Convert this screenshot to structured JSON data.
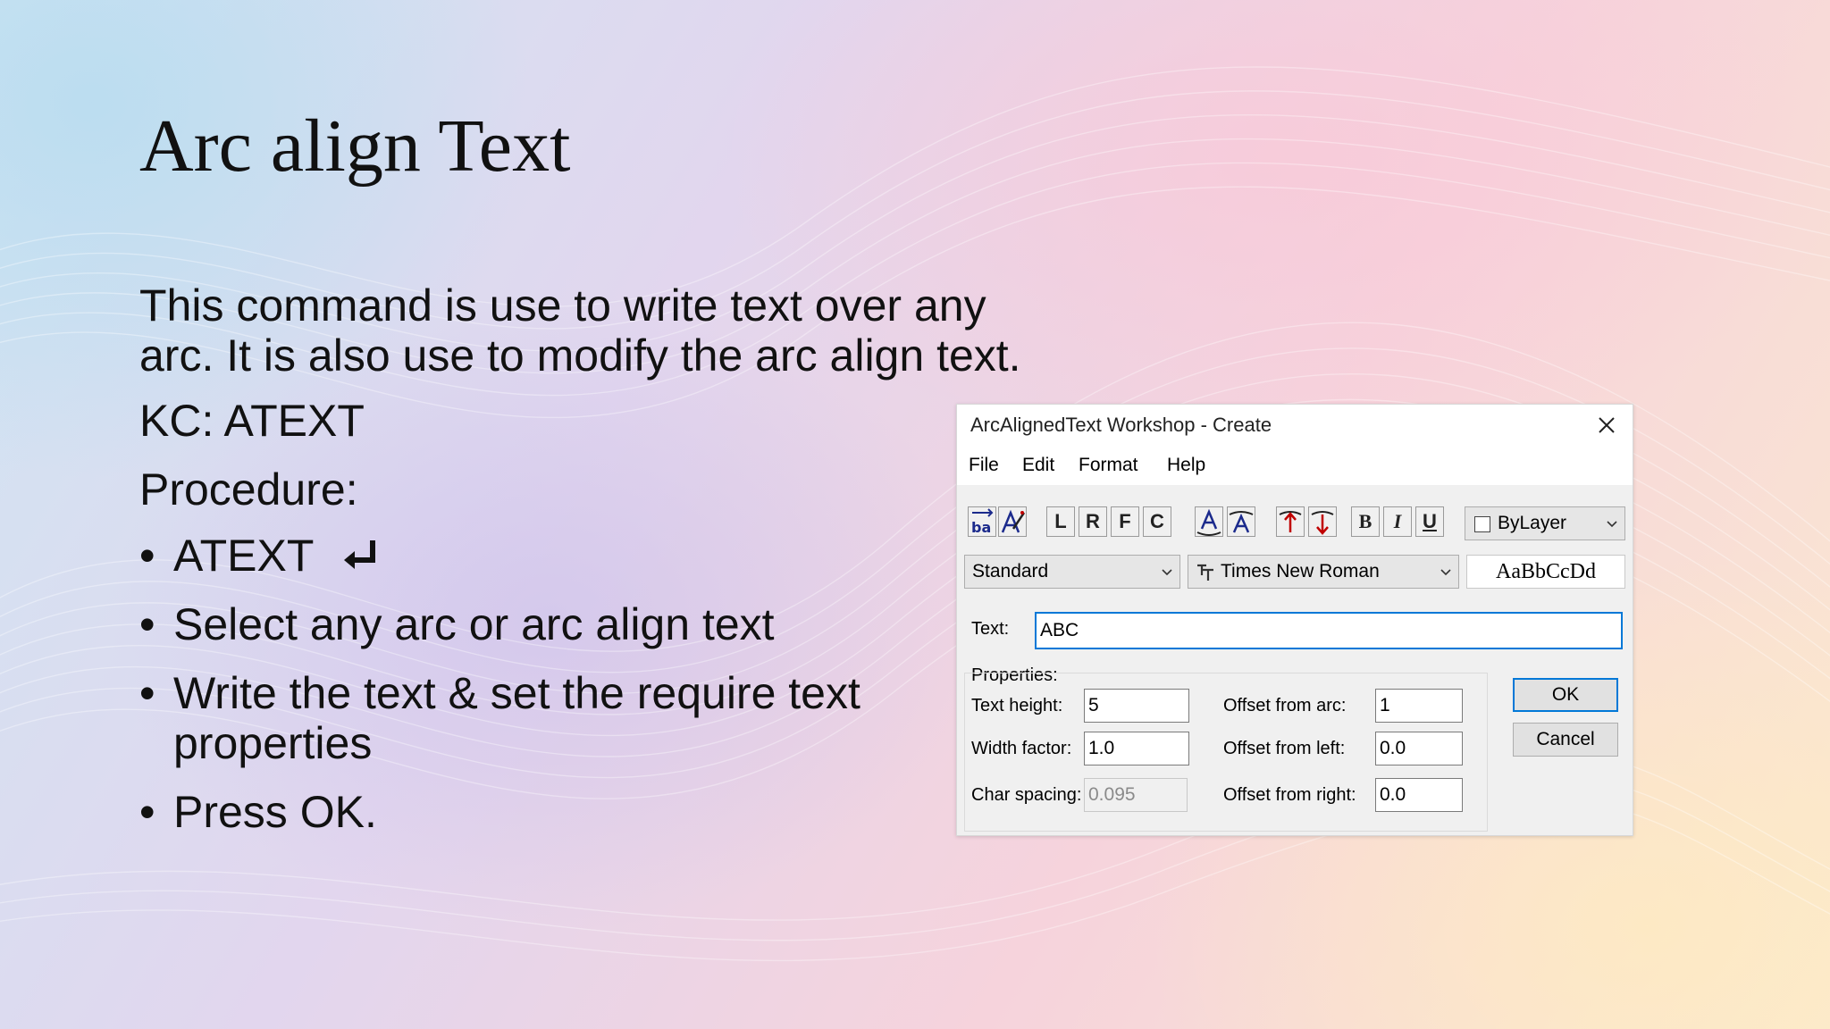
{
  "slide": {
    "title": "Arc align Text",
    "intro": "This command is use to write text over any arc. It is also use to modify the arc align text.",
    "kc": "KC: ATEXT",
    "procedure": "Procedure:",
    "bullets": [
      "ATEXT",
      "Select any arc or arc align text",
      "Write the text & set the require text properties",
      "Press OK."
    ]
  },
  "dialog": {
    "title": "ArcAlignedText Workshop - Create",
    "menu": [
      "File",
      "Edit",
      "Format",
      "Help"
    ],
    "toolbar": {
      "letters": [
        "L",
        "R",
        "F",
        "C"
      ],
      "bold": "B",
      "italic": "I",
      "underline": "U",
      "color_value": "ByLayer",
      "icons": [
        "reverse-text-icon",
        "text-wizard-icon",
        "text-convex-icon",
        "text-concave-icon",
        "inward-text-icon",
        "outward-text-icon"
      ]
    },
    "style_value": "Standard",
    "font_value": "Times New Roman",
    "preview_text": "AaBbCcDd",
    "text_label": "Text:",
    "text_value": "ABC",
    "properties_label": "Properties:",
    "properties": {
      "text_height_label": "Text height:",
      "text_height": "5",
      "width_factor_label": "Width factor:",
      "width_factor": "1.0",
      "char_spacing_label": "Char spacing:",
      "char_spacing": "0.095",
      "offset_arc_label": "Offset from arc:",
      "offset_arc": "1",
      "offset_left_label": "Offset from left:",
      "offset_left": "0.0",
      "offset_right_label": "Offset from right:",
      "offset_right": "0.0"
    },
    "ok_label": "OK",
    "cancel_label": "Cancel",
    "colors": {
      "focus_accent": "#0078d7",
      "arrow_blue": "#1b2a8c",
      "arrow_red": "#c00000"
    }
  }
}
